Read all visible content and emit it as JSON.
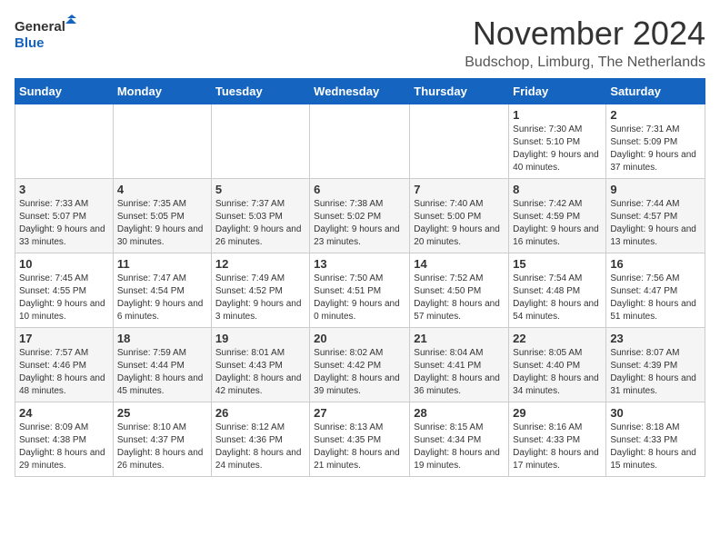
{
  "logo": {
    "line1": "General",
    "line2": "Blue"
  },
  "header": {
    "month": "November 2024",
    "location": "Budschop, Limburg, The Netherlands"
  },
  "days_of_week": [
    "Sunday",
    "Monday",
    "Tuesday",
    "Wednesday",
    "Thursday",
    "Friday",
    "Saturday"
  ],
  "weeks": [
    [
      {
        "day": "",
        "info": ""
      },
      {
        "day": "",
        "info": ""
      },
      {
        "day": "",
        "info": ""
      },
      {
        "day": "",
        "info": ""
      },
      {
        "day": "",
        "info": ""
      },
      {
        "day": "1",
        "info": "Sunrise: 7:30 AM\nSunset: 5:10 PM\nDaylight: 9 hours and 40 minutes."
      },
      {
        "day": "2",
        "info": "Sunrise: 7:31 AM\nSunset: 5:09 PM\nDaylight: 9 hours and 37 minutes."
      }
    ],
    [
      {
        "day": "3",
        "info": "Sunrise: 7:33 AM\nSunset: 5:07 PM\nDaylight: 9 hours and 33 minutes."
      },
      {
        "day": "4",
        "info": "Sunrise: 7:35 AM\nSunset: 5:05 PM\nDaylight: 9 hours and 30 minutes."
      },
      {
        "day": "5",
        "info": "Sunrise: 7:37 AM\nSunset: 5:03 PM\nDaylight: 9 hours and 26 minutes."
      },
      {
        "day": "6",
        "info": "Sunrise: 7:38 AM\nSunset: 5:02 PM\nDaylight: 9 hours and 23 minutes."
      },
      {
        "day": "7",
        "info": "Sunrise: 7:40 AM\nSunset: 5:00 PM\nDaylight: 9 hours and 20 minutes."
      },
      {
        "day": "8",
        "info": "Sunrise: 7:42 AM\nSunset: 4:59 PM\nDaylight: 9 hours and 16 minutes."
      },
      {
        "day": "9",
        "info": "Sunrise: 7:44 AM\nSunset: 4:57 PM\nDaylight: 9 hours and 13 minutes."
      }
    ],
    [
      {
        "day": "10",
        "info": "Sunrise: 7:45 AM\nSunset: 4:55 PM\nDaylight: 9 hours and 10 minutes."
      },
      {
        "day": "11",
        "info": "Sunrise: 7:47 AM\nSunset: 4:54 PM\nDaylight: 9 hours and 6 minutes."
      },
      {
        "day": "12",
        "info": "Sunrise: 7:49 AM\nSunset: 4:52 PM\nDaylight: 9 hours and 3 minutes."
      },
      {
        "day": "13",
        "info": "Sunrise: 7:50 AM\nSunset: 4:51 PM\nDaylight: 9 hours and 0 minutes."
      },
      {
        "day": "14",
        "info": "Sunrise: 7:52 AM\nSunset: 4:50 PM\nDaylight: 8 hours and 57 minutes."
      },
      {
        "day": "15",
        "info": "Sunrise: 7:54 AM\nSunset: 4:48 PM\nDaylight: 8 hours and 54 minutes."
      },
      {
        "day": "16",
        "info": "Sunrise: 7:56 AM\nSunset: 4:47 PM\nDaylight: 8 hours and 51 minutes."
      }
    ],
    [
      {
        "day": "17",
        "info": "Sunrise: 7:57 AM\nSunset: 4:46 PM\nDaylight: 8 hours and 48 minutes."
      },
      {
        "day": "18",
        "info": "Sunrise: 7:59 AM\nSunset: 4:44 PM\nDaylight: 8 hours and 45 minutes."
      },
      {
        "day": "19",
        "info": "Sunrise: 8:01 AM\nSunset: 4:43 PM\nDaylight: 8 hours and 42 minutes."
      },
      {
        "day": "20",
        "info": "Sunrise: 8:02 AM\nSunset: 4:42 PM\nDaylight: 8 hours and 39 minutes."
      },
      {
        "day": "21",
        "info": "Sunrise: 8:04 AM\nSunset: 4:41 PM\nDaylight: 8 hours and 36 minutes."
      },
      {
        "day": "22",
        "info": "Sunrise: 8:05 AM\nSunset: 4:40 PM\nDaylight: 8 hours and 34 minutes."
      },
      {
        "day": "23",
        "info": "Sunrise: 8:07 AM\nSunset: 4:39 PM\nDaylight: 8 hours and 31 minutes."
      }
    ],
    [
      {
        "day": "24",
        "info": "Sunrise: 8:09 AM\nSunset: 4:38 PM\nDaylight: 8 hours and 29 minutes."
      },
      {
        "day": "25",
        "info": "Sunrise: 8:10 AM\nSunset: 4:37 PM\nDaylight: 8 hours and 26 minutes."
      },
      {
        "day": "26",
        "info": "Sunrise: 8:12 AM\nSunset: 4:36 PM\nDaylight: 8 hours and 24 minutes."
      },
      {
        "day": "27",
        "info": "Sunrise: 8:13 AM\nSunset: 4:35 PM\nDaylight: 8 hours and 21 minutes."
      },
      {
        "day": "28",
        "info": "Sunrise: 8:15 AM\nSunset: 4:34 PM\nDaylight: 8 hours and 19 minutes."
      },
      {
        "day": "29",
        "info": "Sunrise: 8:16 AM\nSunset: 4:33 PM\nDaylight: 8 hours and 17 minutes."
      },
      {
        "day": "30",
        "info": "Sunrise: 8:18 AM\nSunset: 4:33 PM\nDaylight: 8 hours and 15 minutes."
      }
    ]
  ]
}
